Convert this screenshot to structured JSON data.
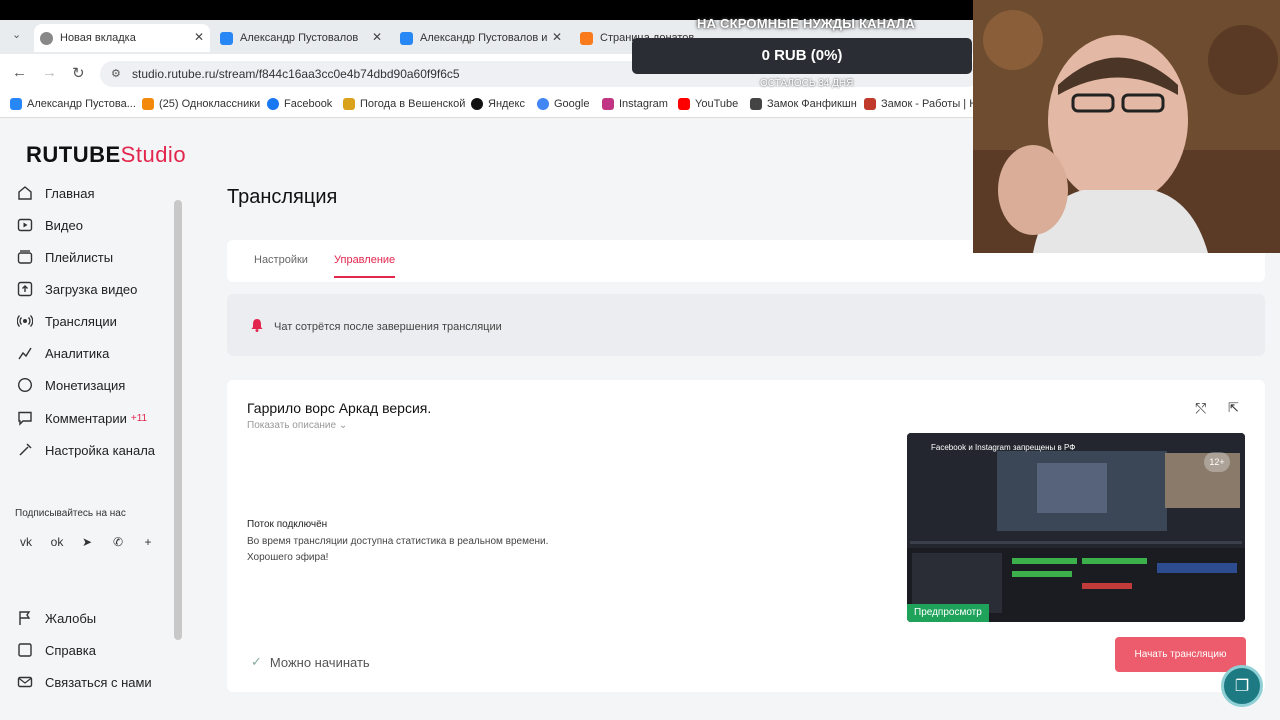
{
  "browser": {
    "tabs": [
      {
        "label": "Новая вкладка",
        "fav": "#888"
      },
      {
        "label": "Александр Пустовалов",
        "fav": "#2787f5"
      },
      {
        "label": "Александр Пустовалов и",
        "fav": "#2787f5"
      },
      {
        "label": "Страница донатов",
        "fav": "#f97b1c"
      }
    ],
    "url": "studio.rutube.ru/stream/f844c16aa3cc0e4b74dbd90a60f9f6c5",
    "bookmarks": [
      {
        "label": "Александр Пустова...",
        "fav": "#2787f5"
      },
      {
        "label": "(25) Одноклассники",
        "fav": "#f2890a"
      },
      {
        "label": "Facebook",
        "fav": "#1877f2"
      },
      {
        "label": "Погода в Вешенской",
        "fav": "#d9a21b"
      },
      {
        "label": "Яндекс",
        "fav": "#111"
      },
      {
        "label": "Google",
        "fav": "#4285f4"
      },
      {
        "label": "Instagram",
        "fav": "#c13584"
      },
      {
        "label": "YouTube",
        "fav": "#ff0000"
      },
      {
        "label": "Замок Фанфикшн",
        "fav": "#444"
      },
      {
        "label": "Замок - Работы | Н...",
        "fav": "#c0392b"
      }
    ]
  },
  "brand": {
    "rutube": "RUTUBE",
    "studio": "Studio"
  },
  "sidebar": {
    "items": [
      {
        "label": "Главная",
        "icon": "home-icon"
      },
      {
        "label": "Видео",
        "icon": "video-icon"
      },
      {
        "label": "Плейлисты",
        "icon": "playlist-icon"
      },
      {
        "label": "Загрузка видео",
        "icon": "upload-icon"
      },
      {
        "label": "Трансляции",
        "icon": "broadcast-icon"
      },
      {
        "label": "Аналитика",
        "icon": "analytics-icon"
      },
      {
        "label": "Монетизация",
        "icon": "money-icon"
      },
      {
        "label": "Комментарии",
        "icon": "comment-icon",
        "badge": "+11"
      },
      {
        "label": "Настройка канала",
        "icon": "settings-icon"
      }
    ],
    "subscribe_label": "Подписывайтесь на нас",
    "footer": [
      {
        "label": "Жалобы",
        "icon": "flag-icon"
      },
      {
        "label": "Справка",
        "icon": "help-icon"
      },
      {
        "label": "Связаться с нами",
        "icon": "mail-icon"
      }
    ]
  },
  "main": {
    "title": "Трансляция",
    "tabs": [
      {
        "label": "Настройки"
      },
      {
        "label": "Управление"
      }
    ],
    "notice": "Чат сотрётся после завершения трансляции",
    "stream": {
      "title": "Гаррило ворс Аркад версия.",
      "show_description": "Показать описание",
      "status_heading": "Поток подключён",
      "status_line1": "Во время трансляции доступна статистика в реальном времени.",
      "status_line2": "Хорошего эфира!",
      "ready": "Можно начинать",
      "preview_label": "Предпросмотр",
      "preview_caption": "Facebook и Instagram запрещены в РФ",
      "age": "12+",
      "start_button": "Начать трансляцию"
    }
  },
  "overlay": {
    "donation_title": "НА СКРОМНЫЕ НУЖДЫ КАНАЛА",
    "donation_amount": "0 RUB (0%)",
    "donation_left": "ОСТАЛОСЬ 34 ДНЯ"
  },
  "colors": {
    "accent": "#e2264d",
    "button": "#ec5c6c",
    "preview_badge": "#1fa35b"
  }
}
